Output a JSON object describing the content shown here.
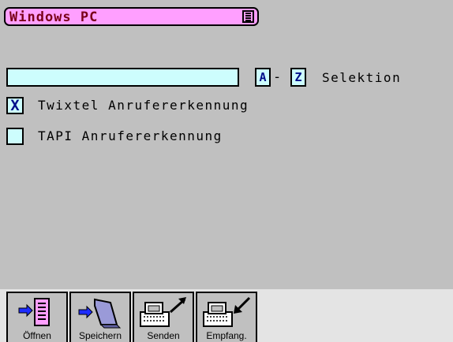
{
  "title_bar": {
    "title": "Windows PC",
    "menu_icon": "menu-icon"
  },
  "selection": {
    "input_value": "",
    "key_from": "A",
    "separator": "-",
    "key_to": "Z",
    "label": "Selektion"
  },
  "options": [
    {
      "label": "Twixtel Anrufererkennung",
      "checked": true,
      "mark": "X"
    },
    {
      "label": "TAPI Anrufererkennung",
      "checked": false,
      "mark": ""
    }
  ],
  "toolbar": {
    "buttons": [
      {
        "label": "Öffnen",
        "icon": "open-document-icon"
      },
      {
        "label": "Speichern",
        "icon": "save-folder-icon"
      },
      {
        "label": "Senden",
        "icon": "fax-send-icon"
      },
      {
        "label": "Empfang.",
        "icon": "fax-receive-icon"
      }
    ]
  }
}
